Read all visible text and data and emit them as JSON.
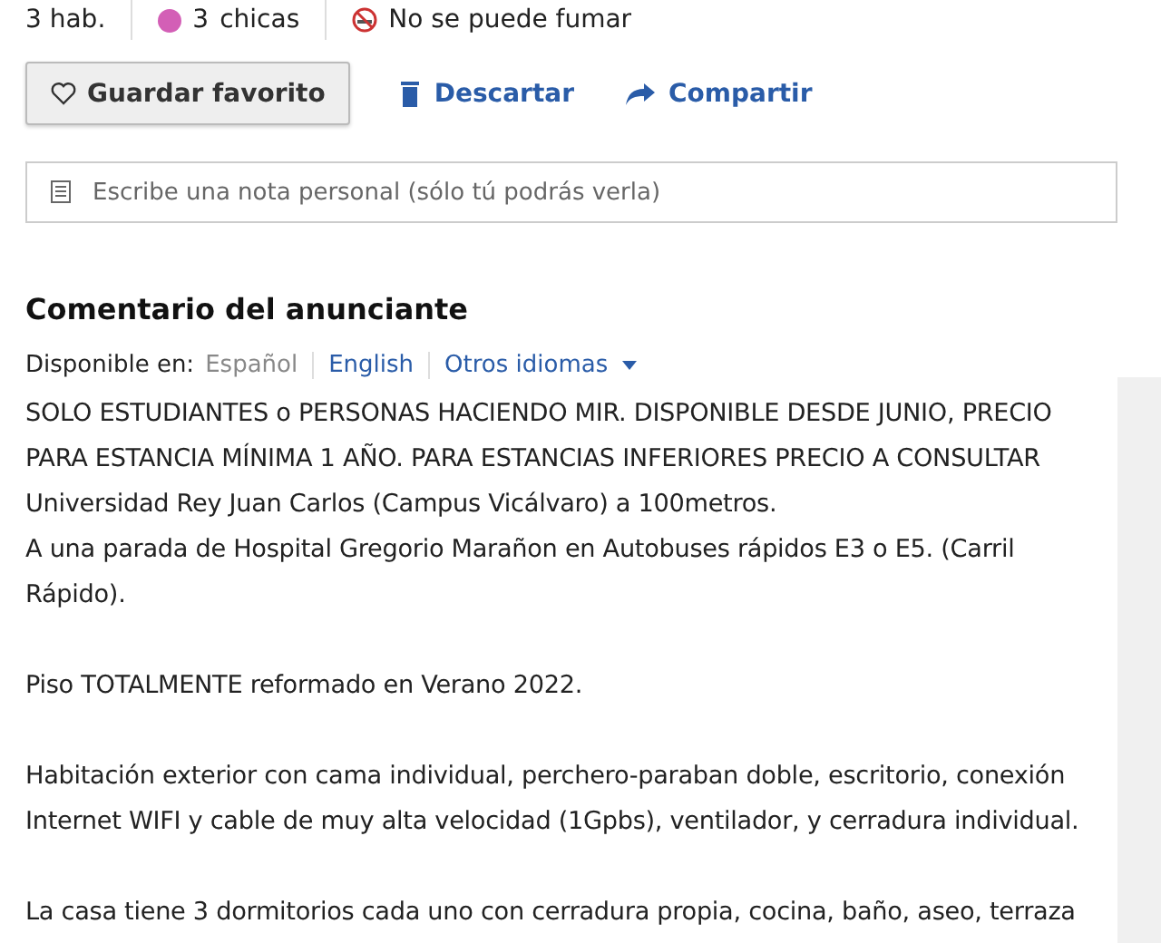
{
  "features": [
    {
      "kind": "plain",
      "text": "3 hab."
    },
    {
      "kind": "dot",
      "count": "3",
      "text": "chicas"
    },
    {
      "kind": "nosmoking",
      "text": "No se puede fumar"
    }
  ],
  "actions": [
    {
      "kind": "favorite",
      "label": "Guardar favorito"
    },
    {
      "kind": "discard",
      "label": "Descartar"
    },
    {
      "kind": "share",
      "label": "Compartir"
    }
  ],
  "note": {
    "placeholder": "Escribe una nota personal (sólo tú podrás verla)"
  },
  "comment": {
    "title": "Comentario del anunciante",
    "languages_label": "Disponible en:",
    "languages": [
      {
        "label": "Español",
        "selected": true
      },
      {
        "label": "English",
        "selected": false
      },
      {
        "label": "Otros idiomas",
        "selected": false,
        "dropdown": true
      }
    ],
    "paragraphs": [
      {
        "lines": [
          "SOLO ESTUDIANTES o PERSONAS HACIENDO MIR. DISPONIBLE DESDE JUNIO, PRECIO",
          "PARA ESTANCIA MÍNIMA 1 AÑO. PARA ESTANCIAS INFERIORES PRECIO A CONSULTAR",
          "Universidad Rey Juan Carlos (Campus Vicálvaro) a 100metros.",
          "A una parada de Hospital Gregorio Marañon en Autobuses rápidos E3 o E5. (Carril",
          "Rápido)."
        ]
      },
      {
        "lines": [
          "Piso TOTALMENTE reformado en Verano 2022."
        ]
      },
      {
        "lines": [
          "Habitación exterior con cama individual, perchero-paraban doble, escritorio, conexión",
          "Internet WIFI y cable de muy alta velocidad (1Gpbs), ventilador, y cerradura individual."
        ]
      },
      {
        "lines": [
          "La casa tiene 3 dormitorios cada uno con cerradura propia, cocina, baño, aseo, terraza"
        ]
      }
    ]
  }
}
